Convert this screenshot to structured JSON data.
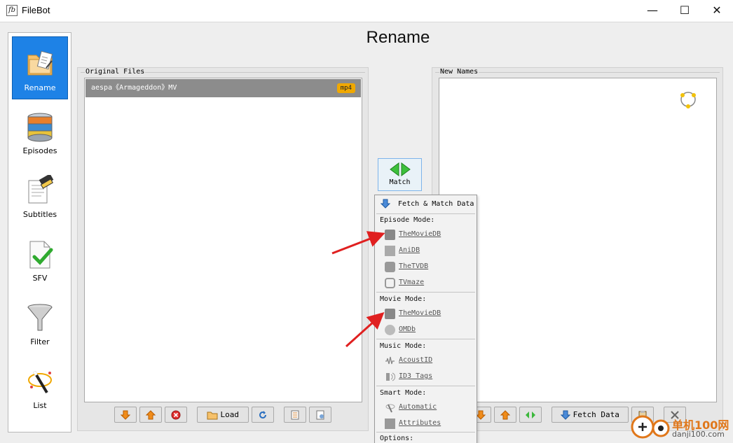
{
  "window": {
    "app_icon_text": "fb",
    "title": "FileBot",
    "minimize_glyph": "—",
    "maximize_glyph": "☐",
    "close_glyph": "✕"
  },
  "header": {
    "title": "Rename"
  },
  "sidebar": {
    "items": [
      {
        "label": "Rename",
        "icon": "rename-folder-icon",
        "active": true
      },
      {
        "label": "Episodes",
        "icon": "database-icon"
      },
      {
        "label": "Subtitles",
        "icon": "subtitles-icon"
      },
      {
        "label": "SFV",
        "icon": "sfv-check-icon"
      },
      {
        "label": "Filter",
        "icon": "funnel-icon"
      },
      {
        "label": "List",
        "icon": "magic-wand-icon"
      }
    ]
  },
  "original_files": {
    "title": "Original Files",
    "files": [
      {
        "name": "aespa《Armageddon》MV",
        "ext": "mp4"
      }
    ],
    "toolbar": {
      "load_label": "Load"
    }
  },
  "new_names": {
    "title": "New Names",
    "toolbar": {
      "fetch_label": "Fetch Data"
    }
  },
  "match": {
    "label": "Match"
  },
  "menu": {
    "fetch_label": "Fetch & Match Data",
    "episode_mode": {
      "label": "Episode Mode:",
      "items": [
        "TheMovieDB",
        "AniDB",
        "TheTVDB",
        "TVmaze"
      ]
    },
    "movie_mode": {
      "label": "Movie Mode:",
      "items": [
        "TheMovieDB",
        "OMDb"
      ]
    },
    "music_mode": {
      "label": "Music Mode:",
      "items": [
        "AcoustID",
        "ID3 Tags"
      ]
    },
    "smart_mode": {
      "label": "Smart Mode:",
      "items": [
        "Automatic",
        "Attributes"
      ]
    },
    "options_label": "Options:"
  },
  "watermark": {
    "text": "单机100网",
    "url": "danji100.com"
  },
  "colors": {
    "accent": "#1e82e6",
    "arrow": "#e02020",
    "badge": "#f0a800"
  }
}
